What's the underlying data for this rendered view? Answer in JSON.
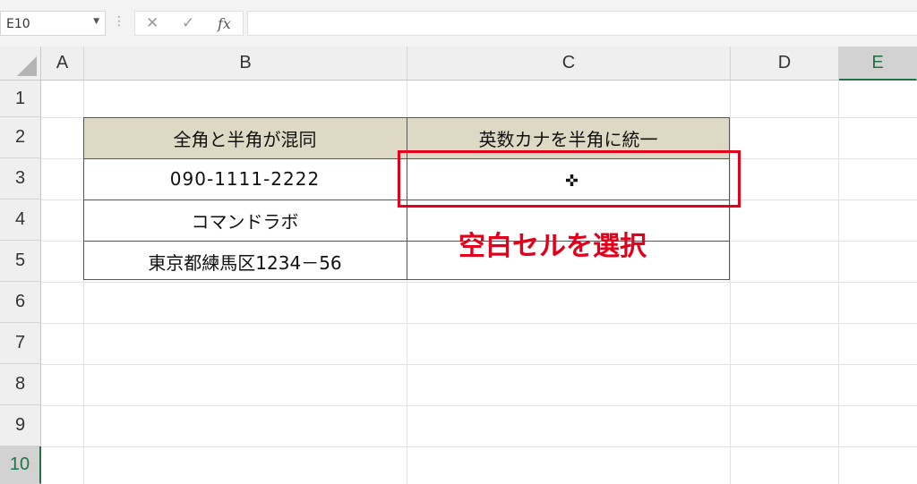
{
  "formula_bar": {
    "name_box": "E10",
    "cancel_icon": "✕",
    "enter_icon": "✓",
    "fx_label": "fx",
    "formula_value": ""
  },
  "columns": [
    "A",
    "B",
    "C",
    "D",
    "E"
  ],
  "selected_column": "E",
  "rows": [
    "1",
    "2",
    "3",
    "4",
    "5",
    "6",
    "7",
    "8",
    "9",
    "10"
  ],
  "selected_row": "10",
  "table": {
    "headers": [
      "全角と半角が混同",
      "英数カナを半角に統一"
    ],
    "rows": [
      [
        "090-1111-2222",
        ""
      ],
      [
        "コマンドラボ",
        ""
      ],
      [
        "東京都練馬区1234－56",
        ""
      ]
    ]
  },
  "annotation": {
    "text": "空白セルを選択",
    "color": "#e4001b"
  },
  "colors": {
    "header_fill": "#ddd9c4",
    "selection_accent": "#217346",
    "highlight": "#e4001b"
  }
}
